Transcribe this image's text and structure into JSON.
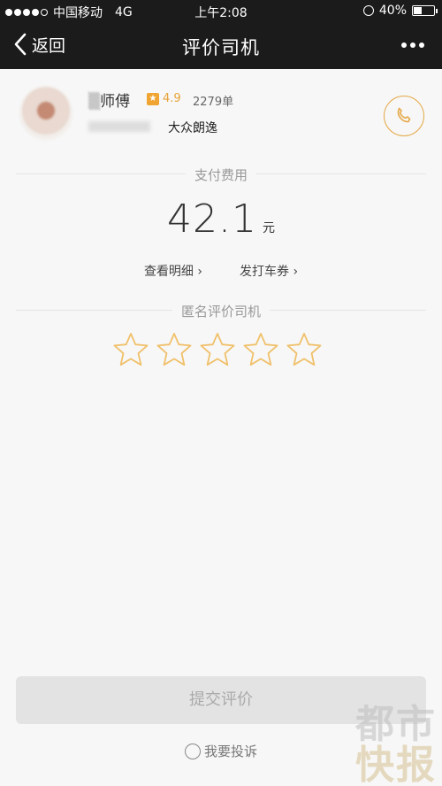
{
  "status_bar": {
    "carrier": "中国移动",
    "network": "4G",
    "time": "上午2:08",
    "battery_percent": "40%",
    "battery_level": 0.4
  },
  "nav": {
    "back_label": "返回",
    "title": "评价司机"
  },
  "driver": {
    "name": "师傅",
    "rating": "4.9",
    "orders": "2279单",
    "car_model": "大众朗逸"
  },
  "payment": {
    "section_label": "支付费用",
    "amount": "42.1",
    "unit": "元",
    "detail_link": "查看明细 ›",
    "coupon_link": "发打车券 ›"
  },
  "review": {
    "section_label": "匿名评价司机",
    "max_stars": 5,
    "selected_stars": 0
  },
  "actions": {
    "submit_label": "提交评价",
    "complain_label": "我要投诉"
  },
  "watermark": {
    "line1": "都市",
    "line2": "快报"
  },
  "colors": {
    "accent": "#e6a94a",
    "star_outline": "#f0c06a",
    "bar": "#1b1b1b"
  },
  "icons": [
    "back-chevron-icon",
    "more-icon",
    "phone-icon",
    "star-icon",
    "complain-icon"
  ]
}
